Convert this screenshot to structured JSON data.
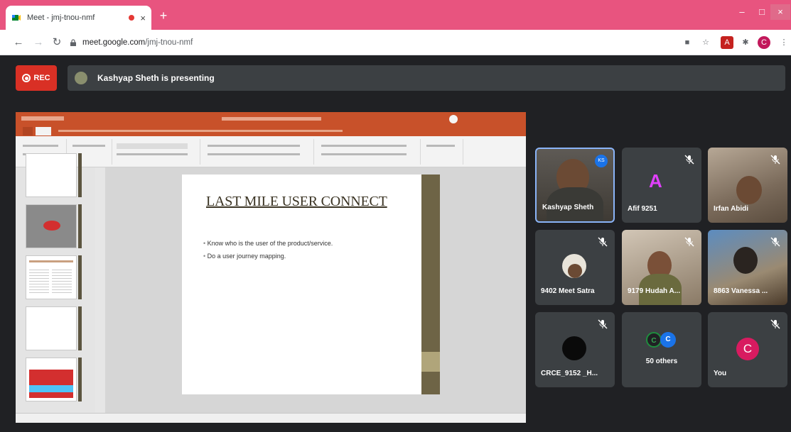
{
  "browser": {
    "tab_title": "Meet - jmj-tnou-nmf",
    "tab_close": "×",
    "new_tab": "+",
    "url_host": "meet.google.com",
    "url_path": "/jmj-tnou-nmf",
    "profile_initial": "C",
    "window_min": "–",
    "window_max": "□",
    "window_close": "×"
  },
  "meet": {
    "rec_label": "REC",
    "presenting_text": "Kashyap Sheth is presenting"
  },
  "slide": {
    "title": "LAST MILE USER CONNECT",
    "bullets": [
      "Know who is the user of the product/service.",
      "Do a user journey mapping."
    ]
  },
  "participants": [
    {
      "name": "Kashyap Sheth",
      "badge": "KS"
    },
    {
      "name": "Afif 9251",
      "initial": "A",
      "color": "#e040fb"
    },
    {
      "name": "Irfan Abidi"
    },
    {
      "name": "9402 Meet Satra"
    },
    {
      "name": "9179 Hudah A..."
    },
    {
      "name": "8863 Vanessa ..."
    },
    {
      "name": "CRCE_9152 _H..."
    },
    {
      "name": "50 others",
      "initials": [
        "C",
        "C"
      ]
    },
    {
      "name": "You",
      "initial": "C",
      "color": "#d81b60"
    }
  ]
}
